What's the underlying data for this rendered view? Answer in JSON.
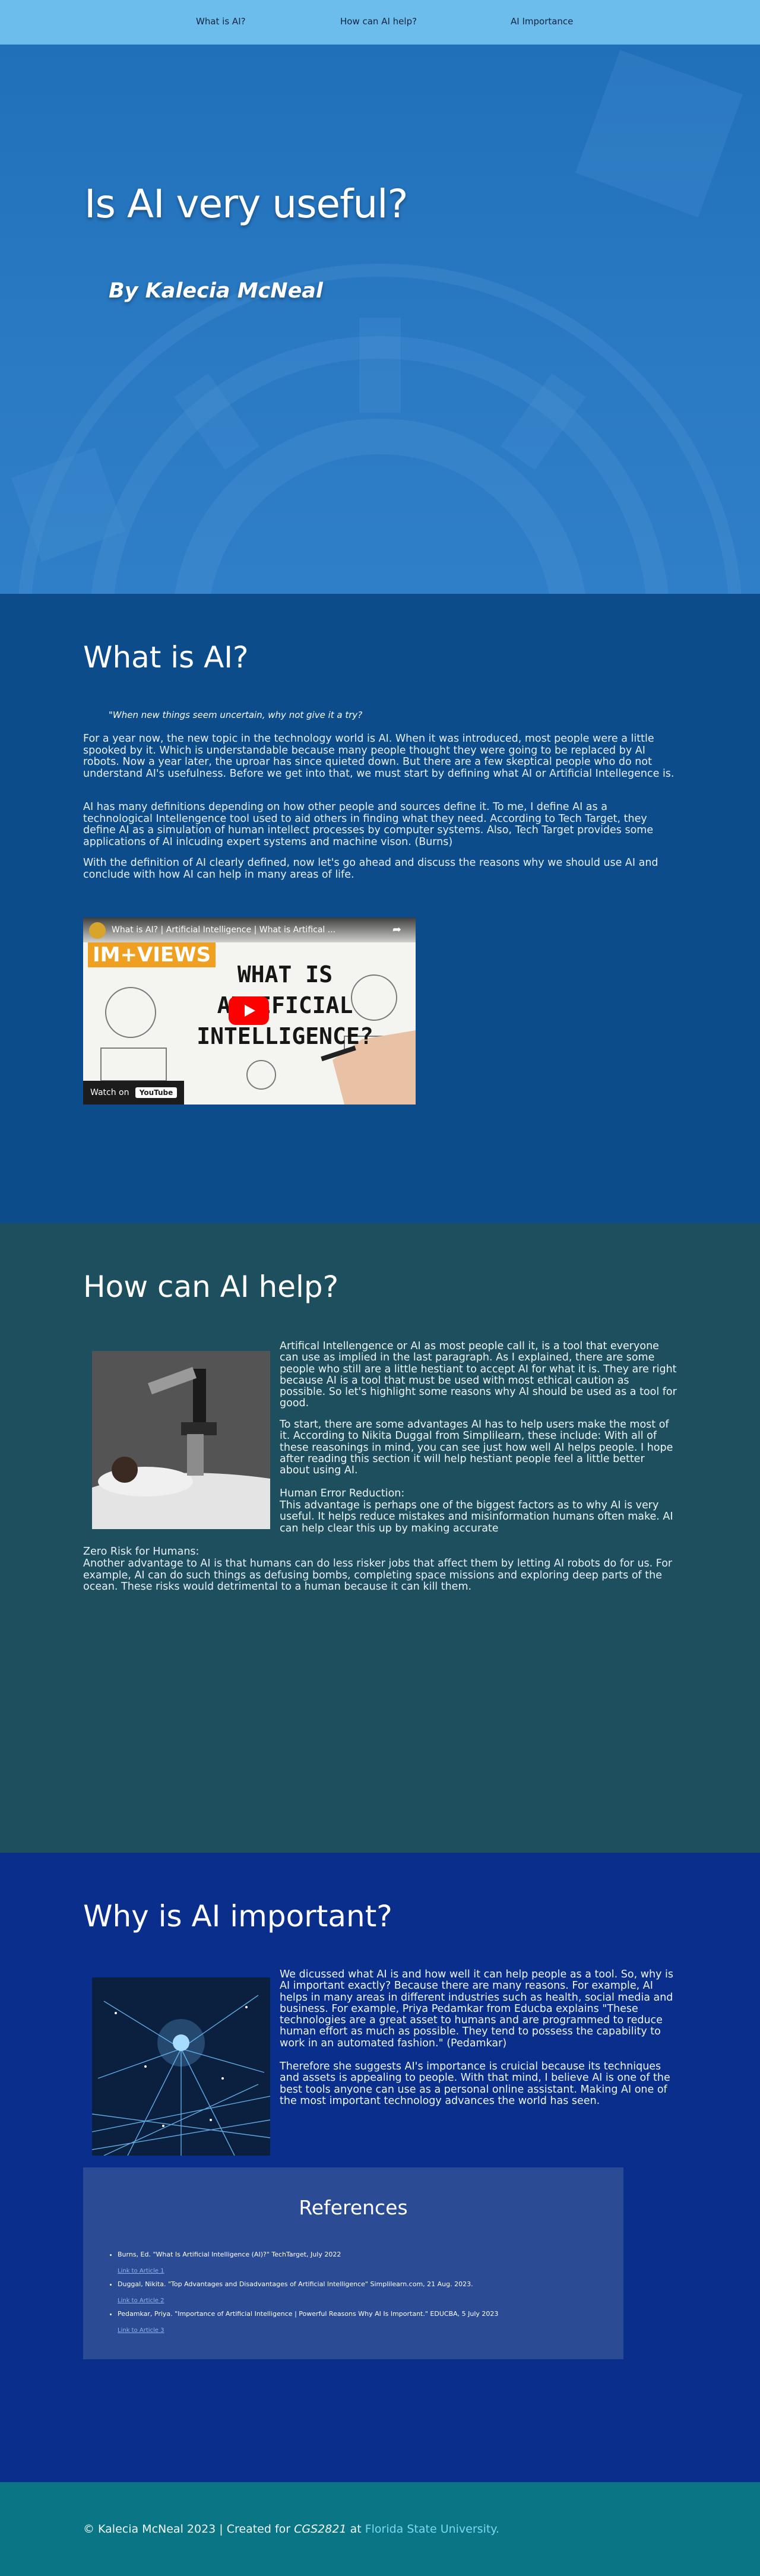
{
  "nav": {
    "items": [
      "What is AI?",
      "How can AI help?",
      "AI Importance"
    ]
  },
  "hero": {
    "title": "Is AI very useful?",
    "author": "By Kalecia McNeal"
  },
  "section1": {
    "title": "What is AI?",
    "quote": "\"When new things seem uncertain, why not give it a try?",
    "paragraphs": [
      "For a year now, the new topic in the technology world is AI. When it was introduced, most people were a little spooked by it. Which is understandable because many people thought they were going to be replaced by AI robots. Now a year later, the uproar has since quieted down. But there are a few skeptical people who do not understand AI's usefulness. Before we get into that, we must start by defining what AI or Artificial Intellegence is.",
      "AI has many definitions depending on how other people and sources define it. To me, I define AI as a technological Intellengence tool used to aid others in finding what they need. According to Tech Target, they define AI as a simulation of human intellect processes by computer systems. Also, Tech Target provides some applications of AI inlcuding expert systems and machine vison. (Burns)",
      "With the definition of AI clearly defined, now let's go ahead and discuss the reasons why we should use AI and conclude with how AI can help in many areas of life."
    ],
    "video": {
      "title": "What is AI? | Artificial Intelligence | What is Artifical ...",
      "brand": "IM+VIEWS",
      "thumb_text": "WHAT IS ARTIFICIAL INTELLIGENCE?",
      "watch_label": "Watch on",
      "platform": "YouTube"
    }
  },
  "section2": {
    "title": "How can AI help?",
    "paragraphs": [
      "Artifical Intellengence or AI as most people call it, is a tool that everyone can use as implied in the last paragraph. As I explained, there are some people who still are a little hestiant to accept AI for what it is. They are right because AI is a tool that must be used with most ethical caution as possible. So let's highlight some reasons why AI should be used as a tool for good.",
      "To start, there are some advantages AI has to help users make the most of it. According to Nikita Duggal from Simplilearn, these include: With all of these reasonings in mind, you can see just how well AI helps people. I hope after reading this section it will help hestiant people feel a little better about using AI."
    ],
    "heading1": "Human Error Reduction:",
    "text1": "This advantage is perhaps one of the biggest factors as to why AI is very useful. It helps reduce mistakes and misinformation humans often make. AI can help clear this up by making accurate",
    "heading2": "Zero Risk for Humans:",
    "text2": "Another advantage to AI is that humans can do less risker jobs that affect them by letting AI robots do for us. For example, AI can do such things as defusing bombs, completing space missions and exploring deep parts of the ocean. These risks would detrimental to a human because it can kill them."
  },
  "section3": {
    "title": "Why is AI important?",
    "paragraphs": [
      "We dicussed what AI is and how well it can help people as a tool. So, why is AI important exactly? Because there are many reasons. For example, AI helps in many areas in different industries such as health, social media and business. For example, Priya Pedamkar from Educba explains \"These technologies are a great asset to humans and are programmed to reduce human effort as much as possible. They tend to possess the capability to work in an automated fashion.\" (Pedamkar)",
      "Therefore she suggests AI's importance is cruicial because its techniques and assets is appealing to people. With that mind, I believe AI is one of the best tools anyone can use as a personal online assistant. Making AI one of the most important technology advances the world has seen."
    ]
  },
  "references": {
    "title": "References",
    "items": [
      {
        "text": "Burns, Ed. \"What Is Artificial Intelligence (AI)?\" TechTarget, July 2022",
        "link": "Link to Article 1"
      },
      {
        "text": "Duggal, Nikita. \"Top Advantages and Disadvantages of Artificial Intelligence\" Simplilearn.com, 21 Aug. 2023.",
        "link": "Link to Article 2"
      },
      {
        "text": "Pedamkar, Priya. \"Importance of Artificial Intelligence | Powerful Reasons Why AI Is Important.\" EDUCBA, 5 July 2023",
        "link": "Link to Article 3"
      }
    ]
  },
  "footer": {
    "prefix": "© Kalecia McNeal 2023 | Created for ",
    "course": "CGS2821",
    "middle": " at ",
    "school": "Florida State University."
  },
  "colors": {
    "nav": "#6cbcec",
    "hero": "#2a79c3",
    "section1": "#0c4c8a",
    "section2": "#1e4f5e",
    "section3": "#0a2e8c",
    "references_box": "#2b4c94",
    "footer": "#097585"
  }
}
